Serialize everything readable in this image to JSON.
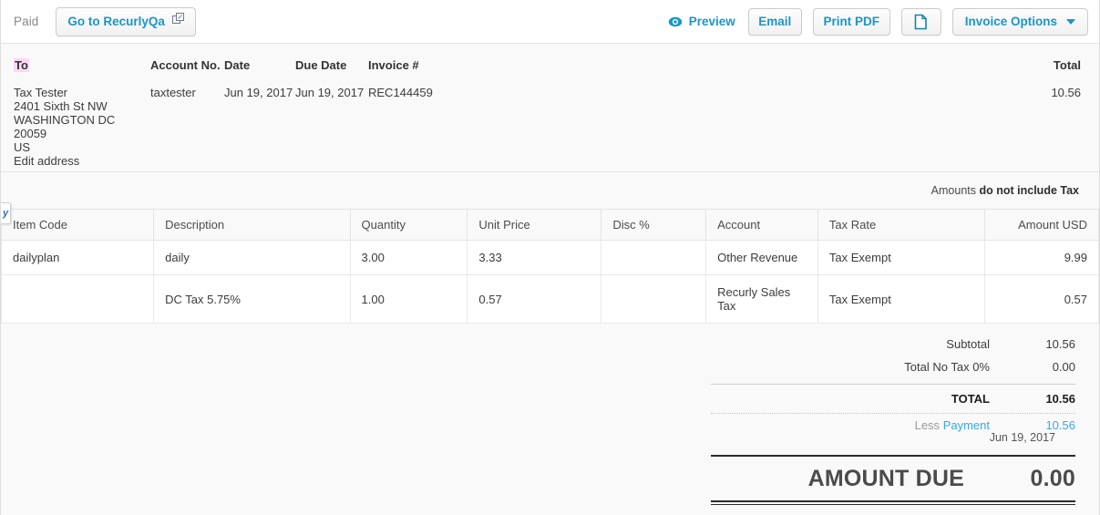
{
  "toolbar": {
    "status": "Paid",
    "goto_label": "Go to RecurlyQa",
    "goto_icon": "external-link-icon",
    "preview_label": "Preview",
    "preview_icon": "eye-icon",
    "email_label": "Email",
    "print_label": "Print PDF",
    "copy_icon": "document-page-icon",
    "options_label": "Invoice Options",
    "caret_icon": "chevron-down-icon",
    "accent_color": "#1b96c6"
  },
  "meta": {
    "to_label": "To",
    "account_no_label": "Account No.",
    "date_label": "Date",
    "due_date_label": "Due Date",
    "invoice_no_label": "Invoice #",
    "total_label": "Total",
    "customer_name": "Tax Tester",
    "address_line1": "2401 Sixth St NW",
    "address_line2": "WASHINGTON DC 20059",
    "address_country": "US",
    "edit_address_label": "Edit address",
    "account_no": "taxtester",
    "date": "Jun 19, 2017",
    "due_date": "Jun 19, 2017",
    "invoice_no": "REC144459",
    "total": "10.56",
    "amounts_note_prefix": "Amounts",
    "amounts_note_strong": "do not include Tax",
    "highlight_color": "#fbd9f5",
    "link_color": "#3ba9dd"
  },
  "table": {
    "columns": [
      "Item Code",
      "Description",
      "Quantity",
      "Unit Price",
      "Disc %",
      "Account",
      "Tax Rate",
      "Amount USD"
    ],
    "rows": [
      {
        "item_code": "dailyplan",
        "description": "daily",
        "quantity": "3.00",
        "unit_price": "3.33",
        "disc": "",
        "account": "Other Revenue",
        "tax_rate": "Tax Exempt",
        "amount": "9.99"
      },
      {
        "item_code": "",
        "description": "DC Tax 5.75%",
        "quantity": "1.00",
        "unit_price": "0.57",
        "disc": "",
        "account": "Recurly Sales Tax",
        "tax_rate": "Tax Exempt",
        "amount": "0.57"
      }
    ]
  },
  "totals": {
    "subtotal_label": "Subtotal",
    "subtotal_value": "10.56",
    "tax_label": "Total No Tax 0%",
    "tax_value": "0.00",
    "total_label": "TOTAL",
    "total_value": "10.56",
    "less_label": "Less",
    "payment_label": "Payment",
    "payment_value": "10.56",
    "payment_date": "Jun 19, 2017",
    "amount_due_label": "AMOUNT DUE",
    "amount_due_value": "0.00"
  },
  "edge_tab": {
    "label": "y"
  }
}
